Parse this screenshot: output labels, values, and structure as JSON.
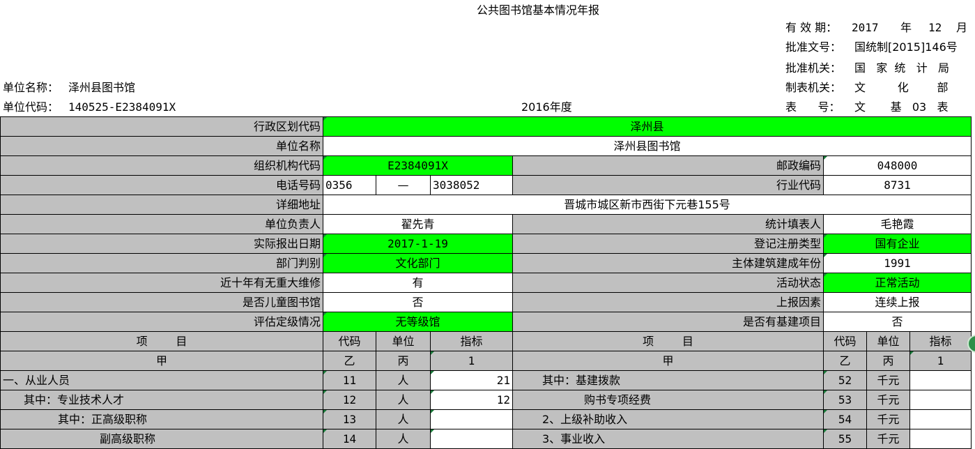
{
  "header": {
    "title": "公共图书馆基本情况年报",
    "valid_label": "有 效 期：",
    "valid_year": "2017",
    "valid_year_unit": "年",
    "valid_month": "12",
    "valid_month_unit": "月",
    "approval_no_label": "批准文号：",
    "approval_no": "国统制[2015]146号",
    "approval_org_label": "批准机关：",
    "approval_org": "国   家  统   计   局",
    "form_org_label": "制表机关：",
    "form_org": "文         化        部",
    "form_no_label": "表      号：",
    "form_no": "文       基   03   表",
    "unit_name_label": "单位名称：",
    "unit_name": "泽州县图书馆",
    "unit_code_label": "单位代码：",
    "unit_code": "140525-E2384091X",
    "year": "2016年度"
  },
  "info": {
    "region_code_label": "行政区划代码",
    "region_code": "泽州县",
    "unit_name_label": "单位名称",
    "unit_name": "泽州县图书馆",
    "org_code_label": "组织机构代码",
    "org_code": "E2384091X",
    "postcode_label": "邮政编码",
    "postcode": "048000",
    "phone_label": "电话号码",
    "phone_area": "0356",
    "phone_sep": "—",
    "phone_number": "3038052",
    "industry_code_label": "行业代码",
    "industry_code": "8731",
    "address_label": "详细地址",
    "address": "晋城市城区新市西街下元巷155号",
    "head_label": "单位负责人",
    "head": "翟先青",
    "filler_label": "统计填表人",
    "filler": "毛艳霞",
    "report_date_label": "实际报出日期",
    "report_date": "2017-1-19",
    "reg_type_label": "登记注册类型",
    "reg_type": "国有企业",
    "dept_label": "部门判别",
    "dept": "文化部门",
    "build_year_label": "主体建筑建成年份",
    "build_year": "1991",
    "repair_label": "近十年有无重大维修",
    "repair": "有",
    "activity_label": "活动状态",
    "activity": "正常活动",
    "children_label": "是否儿童图书馆",
    "children": "否",
    "report_factor_label": "上报因素",
    "report_factor": "连续上报",
    "grade_label": "评估定级情况",
    "grade": "无等级馆",
    "infra_label": "是否有基建项目",
    "infra": "否"
  },
  "columns": {
    "item": "项        目",
    "code": "代码",
    "unit": "单位",
    "index": "指标",
    "row_a": "甲",
    "row_b": "乙",
    "row_c": "丙",
    "row_1": "1"
  },
  "rows": [
    {
      "left_item": "一、从业人员",
      "left_code": "11",
      "left_unit": "人",
      "left_value": "21",
      "right_item": "其中：基建拨款",
      "right_code": "52",
      "right_unit": "千元",
      "right_value": ""
    },
    {
      "left_item": "其中：专业技术人才",
      "left_code": "12",
      "left_unit": "人",
      "left_value": "12",
      "right_item": "购书专项经费",
      "right_code": "53",
      "right_unit": "千元",
      "right_value": ""
    },
    {
      "left_item": "其中：正高级职称",
      "left_code": "13",
      "left_unit": "人",
      "left_value": "",
      "right_item": "2、上级补助收入",
      "right_code": "54",
      "right_unit": "千元",
      "right_value": ""
    },
    {
      "left_item": "副高级职称",
      "left_code": "14",
      "left_unit": "人",
      "left_value": "",
      "right_item": "3、事业收入",
      "right_code": "55",
      "right_unit": "千元",
      "right_value": ""
    }
  ],
  "colors": {
    "header_grey": "#c0c0c0",
    "highlight_green": "#00ff00",
    "marker_green": "#1a7a3a"
  }
}
